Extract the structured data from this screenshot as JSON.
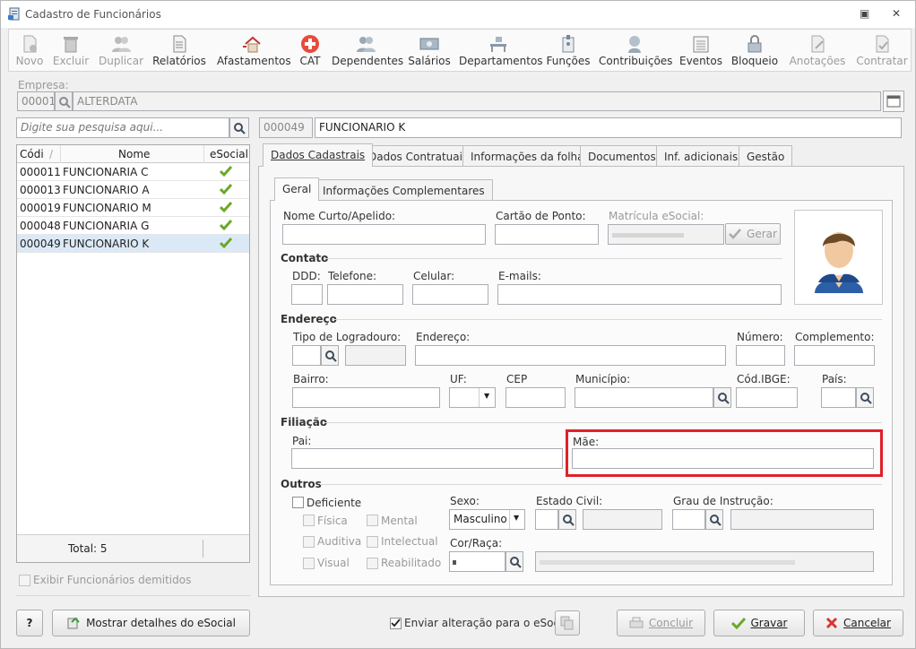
{
  "window": {
    "title": "Cadastro de Funcionários",
    "min_glyph": "▣",
    "close_glyph": "✕"
  },
  "toolbar": [
    {
      "label": "Novo",
      "icon": "new-doc-icon",
      "enabled": false
    },
    {
      "label": "Excluir",
      "icon": "trash-icon",
      "enabled": false
    },
    {
      "label": "Duplicar",
      "icon": "duplicate-users-icon",
      "enabled": false
    },
    {
      "label": "Relatórios",
      "icon": "report-icon",
      "enabled": true
    },
    {
      "label": "Afastamentos",
      "icon": "house-icon",
      "enabled": true
    },
    {
      "label": "CAT",
      "icon": "medical-cross-icon",
      "enabled": true
    },
    {
      "label": "Dependentes",
      "icon": "users-icon",
      "enabled": true
    },
    {
      "label": "Salários",
      "icon": "money-icon",
      "enabled": true
    },
    {
      "label": "Departamentos",
      "icon": "desk-icon",
      "enabled": true
    },
    {
      "label": "Funções",
      "icon": "badge-icon",
      "enabled": true
    },
    {
      "label": "Contribuições",
      "icon": "contribution-icon",
      "enabled": true
    },
    {
      "label": "Eventos",
      "icon": "events-icon",
      "enabled": true
    },
    {
      "label": "Bloqueio",
      "icon": "lock-icon",
      "enabled": true
    },
    {
      "label": "Anotações",
      "icon": "notes-icon",
      "enabled": false
    },
    {
      "label": "Contratar",
      "icon": "contract-icon",
      "enabled": false
    }
  ],
  "empresa": {
    "label": "Empresa:",
    "code": "00001",
    "name": "ALTERDATA"
  },
  "search": {
    "placeholder": "Digite sua pesquisa aqui..."
  },
  "selected_employee": {
    "code": "000049",
    "name": "FUNCIONARIO K"
  },
  "list": {
    "headers": {
      "code": "Códi",
      "name": "Nome",
      "esocial": "eSocial"
    },
    "rows": [
      {
        "code": "000011",
        "name": "FUNCIONARIA C"
      },
      {
        "code": "000013",
        "name": "FUNCIONARIO A"
      },
      {
        "code": "000019",
        "name": "FUNCIONARIO M"
      },
      {
        "code": "000048",
        "name": "FUNCIONARIA G"
      },
      {
        "code": "000049",
        "name": "FUNCIONARIO K"
      }
    ],
    "total": "Total: 5",
    "show_dismissed": "Exibir Funcionários demitidos"
  },
  "tabs": [
    "Dados Cadastrais",
    "Dados Contratuais",
    "Informações da folha",
    "Documentos",
    "Inf. adicionais",
    "Gestão"
  ],
  "subtabs": [
    "Geral",
    "Informações Complementares"
  ],
  "form": {
    "nome_curto": "Nome Curto/Apelido:",
    "cartao_ponto": "Cartão de Ponto:",
    "matricula": "Matrícula eSocial:",
    "gerar": "Gerar",
    "contato": "Contato",
    "ddd": "DDD:",
    "telefone": "Telefone:",
    "celular": "Celular:",
    "emails": "E-mails:",
    "endereco_section": "Endereço",
    "tipo_logradouro": "Tipo de Logradouro:",
    "endereco": "Endereço:",
    "numero": "Número:",
    "complemento": "Complemento:",
    "bairro": "Bairro:",
    "uf": "UF:",
    "cep": "CEP",
    "municipio": "Município:",
    "cod_ibge": "Cód.IBGE:",
    "pais": "País:",
    "filiacao": "Filiação",
    "pai": "Pai:",
    "mae": "Mãe:",
    "outros": "Outros",
    "deficiente": "Deficiente",
    "fisica": "Física",
    "mental": "Mental",
    "auditiva": "Auditiva",
    "intelectual": "Intelectual",
    "visual": "Visual",
    "reabilitado": "Reabilitado",
    "sexo": "Sexo:",
    "sexo_value": "Masculino",
    "estado_civil": "Estado Civil:",
    "grau_instrucao": "Grau de Instrução:",
    "cor_raca": "Cor/Raça:"
  },
  "footer": {
    "help": "?",
    "mostrar_esocial": "Mostrar detalhes do eSocial",
    "enviar_alteracao": "Enviar alteração para o eSocial",
    "concluir": "Concluir",
    "gravar": "Gravar",
    "cancelar": "Cancelar"
  },
  "colors": {
    "highlight": "#e0202a",
    "check_green": "#6aa82a",
    "selected_row": "#dbe9f7"
  }
}
